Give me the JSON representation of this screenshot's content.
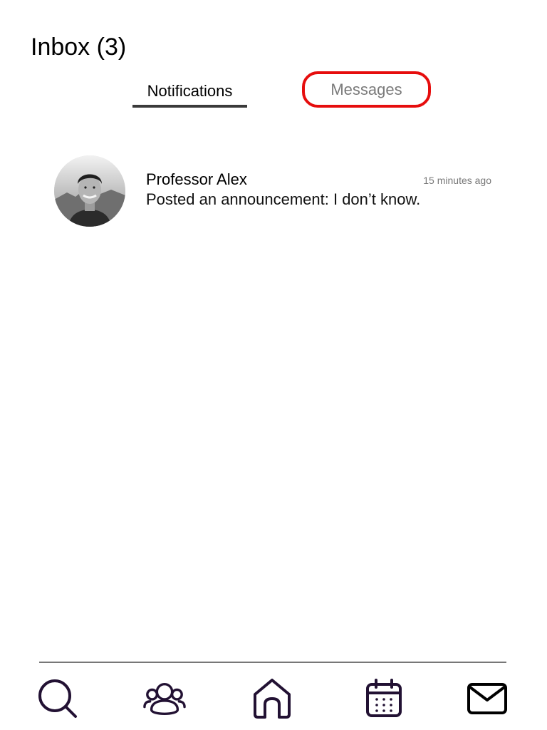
{
  "header": {
    "title": "Inbox (3)"
  },
  "tabs": [
    {
      "label": "Notifications",
      "active": true
    },
    {
      "label": "Messages",
      "active": false,
      "highlighted": true
    }
  ],
  "notifications": [
    {
      "sender": "Professor Alex",
      "time": "15 minutes ago",
      "text": "Posted an announcement: I don’t know.",
      "avatar": "profile-photo"
    }
  ],
  "bottom_nav": {
    "items": [
      {
        "icon": "search-icon"
      },
      {
        "icon": "group-icon"
      },
      {
        "icon": "home-icon"
      },
      {
        "icon": "calendar-icon"
      },
      {
        "icon": "mail-icon"
      }
    ]
  },
  "colors": {
    "highlight": "#e60d0d",
    "nav_icon": "#221133",
    "tab_underline": "#3a3a3a",
    "inactive_tab_text": "#7a7a7a"
  }
}
